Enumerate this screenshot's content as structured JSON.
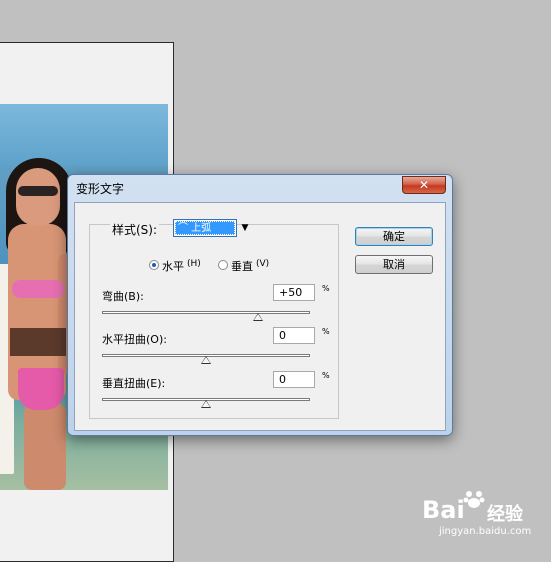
{
  "dialog": {
    "title": "变形文字",
    "close_label": "✕",
    "style_label": "样式(S):",
    "style_value": "⌒ 上弧",
    "style_dropdown_icon": "chevron-down-icon",
    "orientation": {
      "horizontal_label": "水平",
      "horizontal_key": "(H)",
      "vertical_label": "垂直",
      "vertical_key": "(V)",
      "selected": "horizontal"
    },
    "bend": {
      "label": "弯曲(B):",
      "value": "+50",
      "unit": "%",
      "slider_fraction": 0.75
    },
    "hdistort": {
      "label": "水平扭曲(O):",
      "value": "0",
      "unit": "%",
      "slider_fraction": 0.5
    },
    "vdistort": {
      "label": "垂直扭曲(E):",
      "value": "0",
      "unit": "%",
      "slider_fraction": 0.5
    },
    "ok_label": "确定",
    "cancel_label": "取消"
  },
  "watermark": {
    "brand": "Bai",
    "brand_suffix": "经验",
    "url": "jingyan.baidu.com"
  }
}
